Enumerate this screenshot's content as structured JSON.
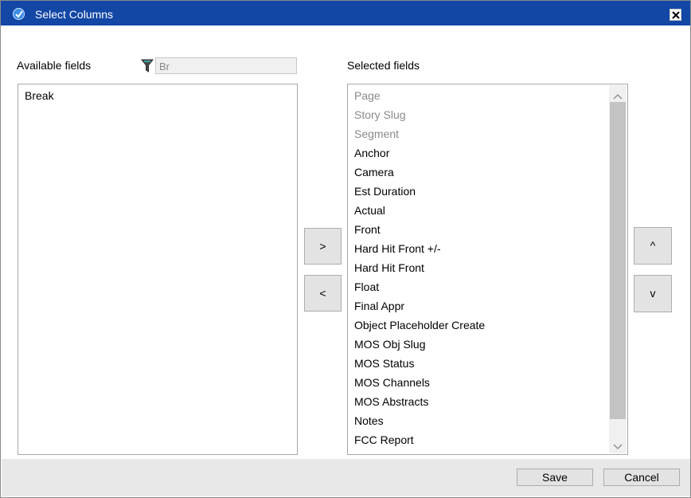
{
  "window": {
    "title": "Select Columns",
    "close_label": "×"
  },
  "available": {
    "label": "Available fields",
    "filter_value": "Br",
    "items": [
      "Break"
    ]
  },
  "selected": {
    "label": "Selected fields",
    "items": [
      {
        "label": "Page",
        "disabled": true
      },
      {
        "label": "Story Slug",
        "disabled": true
      },
      {
        "label": "Segment",
        "disabled": true
      },
      {
        "label": "Anchor",
        "disabled": false
      },
      {
        "label": "Camera",
        "disabled": false
      },
      {
        "label": "Est Duration",
        "disabled": false
      },
      {
        "label": "Actual",
        "disabled": false
      },
      {
        "label": "Front",
        "disabled": false
      },
      {
        "label": "Hard Hit Front +/-",
        "disabled": false
      },
      {
        "label": "Hard Hit Front",
        "disabled": false
      },
      {
        "label": "Float",
        "disabled": false
      },
      {
        "label": "Final Appr",
        "disabled": false
      },
      {
        "label": "Object Placeholder Create",
        "disabled": false
      },
      {
        "label": "MOS Obj Slug",
        "disabled": false
      },
      {
        "label": "MOS Status",
        "disabled": false
      },
      {
        "label": "MOS Channels",
        "disabled": false
      },
      {
        "label": "MOS Abstracts",
        "disabled": false
      },
      {
        "label": "Notes",
        "disabled": false
      },
      {
        "label": "FCC Report",
        "disabled": false
      }
    ]
  },
  "transfer": {
    "add_label": ">",
    "remove_label": "<"
  },
  "order": {
    "up_label": "^",
    "down_label": "v"
  },
  "footer": {
    "save_label": "Save",
    "cancel_label": "Cancel"
  },
  "colors": {
    "titlebar": "#1347a6",
    "disabled_text": "#8a8a8a"
  }
}
